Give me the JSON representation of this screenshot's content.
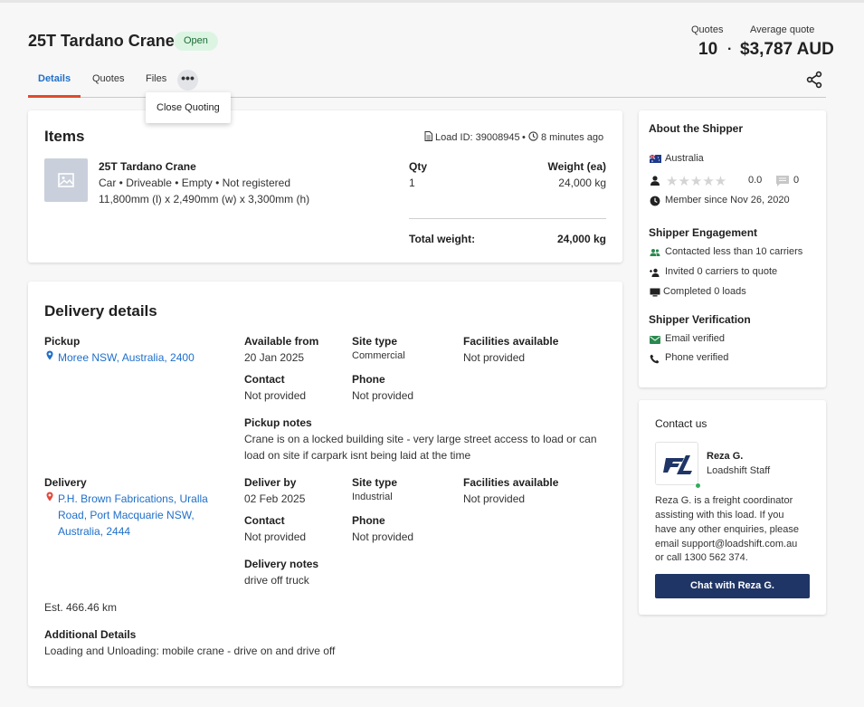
{
  "header": {
    "title": "25T Tardano Crane",
    "status": "Open",
    "quotes_label": "Quotes",
    "quotes_value": "10",
    "avg_label": "Average quote",
    "avg_value": "$3,787 AUD",
    "separator": "·"
  },
  "tabs": [
    {
      "label": "Details",
      "active": true
    },
    {
      "label": "Quotes",
      "active": false
    },
    {
      "label": "Files",
      "active": false
    }
  ],
  "more_menu": {
    "button": "•••",
    "item": "Close Quoting"
  },
  "items": {
    "heading": "Items",
    "load_id": "Load ID: 39008945",
    "bullet": "•",
    "time_ago": "8 minutes ago",
    "item_name": "25T Tardano Crane",
    "item_desc": "Car • Driveable • Empty • Not registered",
    "item_dims": "11,800mm (l) x 2,490mm (w) x 3,300mm (h)",
    "qty_label": "Qty",
    "qty_value": "1",
    "weight_label": "Weight (ea)",
    "weight_value": "24,000 kg",
    "total_label": "Total weight:",
    "total_value": "24,000 kg"
  },
  "delivery": {
    "heading": "Delivery details",
    "pickup_label": "Pickup",
    "pickup_address": "Moree NSW, Australia, 2400",
    "available_label": "Available from",
    "available_value": "20 Jan 2025",
    "pickup_site_label": "Site type",
    "pickup_site_value": "Commercial",
    "pickup_fac_label": "Facilities available",
    "pickup_fac_value": "Not provided",
    "pickup_contact_label": "Contact",
    "pickup_contact_value": "Not provided",
    "pickup_phone_label": "Phone",
    "pickup_phone_value": "Not provided",
    "pickup_notes_label": "Pickup notes",
    "pickup_notes_line1": "Crane is on a locked building site - very large street access to load or can",
    "pickup_notes_line2": "load on site if carpark isnt being laid at the time",
    "delivery_label": "Delivery",
    "delivery_addr_line1": "P.H. Brown Fabrications, Uralla",
    "delivery_addr_line2": "Road, Port Macquarie NSW,",
    "delivery_addr_line3": "Australia, 2444",
    "deliver_by_label": "Deliver by",
    "deliver_by_value": "02 Feb 2025",
    "delivery_site_label": "Site type",
    "delivery_site_value": "Industrial",
    "delivery_fac_label": "Facilities available",
    "delivery_fac_value": "Not provided",
    "delivery_contact_label": "Contact",
    "delivery_contact_value": "Not provided",
    "delivery_phone_label": "Phone",
    "delivery_phone_value": "Not provided",
    "delivery_notes_label": "Delivery notes",
    "delivery_notes_value": "drive off truck",
    "distance": "Est. 466.46 km",
    "additional_label": "Additional Details",
    "additional_value": "Loading and Unloading: mobile crane - drive on and drive off"
  },
  "shipper": {
    "heading": "About the Shipper",
    "country": "Australia",
    "rating": "0.0",
    "reviews": "0",
    "stars": "★★★★★",
    "member_since": "Member since Nov 26, 2020",
    "engagement_heading": "Shipper Engagement",
    "contacted": "Contacted less than 10 carriers",
    "invited": "Invited 0 carriers to quote",
    "completed": "Completed 0 loads",
    "verification_heading": "Shipper Verification",
    "email_verified": "Email verified",
    "phone_verified": "Phone verified"
  },
  "contact": {
    "heading": "Contact us",
    "name": "Reza G.",
    "role": "Loadshift Staff",
    "desc_line1": "Reza G. is a freight coordinator",
    "desc_line2": "assisting with this load. If you",
    "desc_line3": "have any other enquiries, please",
    "desc_line4": "email support@loadshift.com.au",
    "desc_line5": "or call 1300 562 374.",
    "chat_button": "Chat with Reza G."
  },
  "colors": {
    "accent_blue": "#1f6fc9",
    "tab_underline": "#e04a2c",
    "open_badge_bg": "#dcf5e3",
    "chat_button_bg": "#1f3566",
    "verified_green": "#2fae5b"
  }
}
